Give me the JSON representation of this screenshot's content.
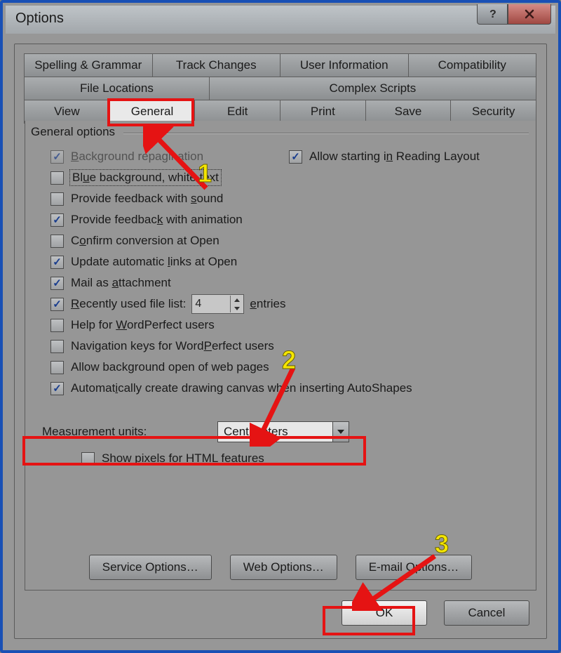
{
  "window": {
    "title": "Options"
  },
  "tabs": {
    "row1": [
      "Spelling & Grammar",
      "Track Changes",
      "User Information",
      "Compatibility"
    ],
    "row2": [
      "File Locations",
      "Complex Scripts"
    ],
    "row3": [
      "View",
      "General",
      "Edit",
      "Print",
      "Save",
      "Security"
    ],
    "selected": "General"
  },
  "group_title": "General options",
  "options": {
    "bg_repag": {
      "label": "Background repagination",
      "checked": true,
      "disabled": true,
      "u": "B"
    },
    "blue_bg": {
      "label": "Blue background, white text",
      "checked": false,
      "u": "u"
    },
    "fb_sound": {
      "label": "Provide feedback with sound",
      "checked": false,
      "u": "s"
    },
    "fb_anim": {
      "label": "Provide feedback with animation",
      "checked": true,
      "u": "k"
    },
    "confirm_open": {
      "label": "Confirm conversion at Open",
      "checked": false,
      "u": "o"
    },
    "upd_links": {
      "label": "Update automatic links at Open",
      "checked": true,
      "u": "l"
    },
    "mail_attach": {
      "label": "Mail as attachment",
      "checked": true,
      "u": "a"
    },
    "recent": {
      "label": "Recently used file list:",
      "checked": true,
      "u": "R",
      "value": "4",
      "suffix": "entries",
      "suffix_u": "e"
    },
    "help_wp": {
      "label": "Help for WordPerfect users",
      "checked": false,
      "u": "W"
    },
    "navkeys_wp": {
      "label": "Navigation keys for WordPerfect users",
      "checked": false,
      "u": "P"
    },
    "bg_open_web": {
      "label": "Allow background open of web pages",
      "checked": false,
      "u": "g"
    },
    "auto_canvas": {
      "label": "Automatically create drawing canvas when inserting AutoShapes",
      "checked": true,
      "u": "i"
    },
    "allow_read": {
      "label": "Allow starting in Reading Layout",
      "checked": true,
      "u": "n"
    }
  },
  "measurement": {
    "label": "Measurement units:",
    "u": "M",
    "value": "Centimeters"
  },
  "pixels": {
    "label": "Show pixels for HTML features",
    "checked": false,
    "u": "x"
  },
  "buttons": {
    "service": "Service Options…",
    "web": "Web Options…",
    "email": "E-mail Options…",
    "ok": "OK",
    "cancel": "Cancel"
  },
  "annotations": {
    "step1": "1",
    "step2": "2",
    "step3": "3"
  }
}
